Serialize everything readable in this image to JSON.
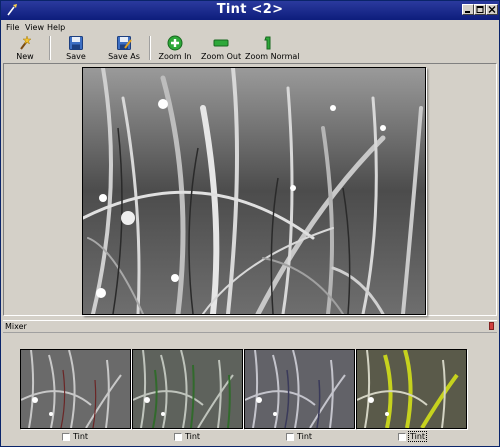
{
  "window": {
    "title": "Tint <2>"
  },
  "menu": {
    "items": [
      "File",
      "View",
      "Help"
    ]
  },
  "toolbar": {
    "new": "New",
    "save": "Save",
    "save_as": "Save As",
    "zoom_in": "Zoom In",
    "zoom_out": "Zoom Out",
    "zoom_normal": "Zoom Normal"
  },
  "mixer": {
    "label": "Mixer",
    "thumbnails": [
      {
        "tint_label": "Tint",
        "checked": false,
        "accent": "#6b1f1f"
      },
      {
        "tint_label": "Tint",
        "checked": false,
        "accent": "#2f6b2a"
      },
      {
        "tint_label": "Tint",
        "checked": false,
        "accent": "#3a3a5a"
      },
      {
        "tint_label": "Tint",
        "checked": false,
        "accent": "#c6d21e"
      }
    ]
  },
  "colors": {
    "titlebar": "#0d1d7c",
    "chrome": "#d4d0c8"
  },
  "icons": [
    "app-icon",
    "wand-icon",
    "floppy-icon",
    "floppy-edit-icon",
    "zoom-in-icon",
    "zoom-out-icon",
    "zoom-normal-icon"
  ]
}
